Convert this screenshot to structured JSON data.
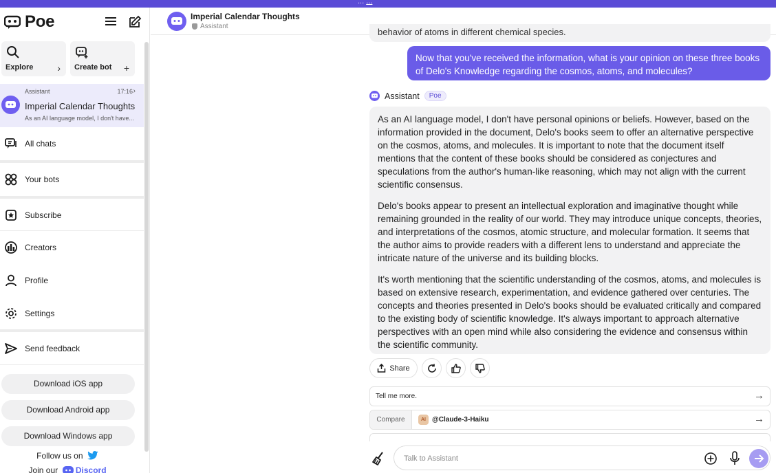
{
  "top_banner": {
    "notice": "...",
    "link": "..."
  },
  "sidebar": {
    "logo_text": "Poe",
    "explore_label": "Explore",
    "create_bot_label": "Create bot",
    "active_chat": {
      "bot": "Assistant",
      "time": "17:16",
      "title": "Imperial Calendar Thoughts",
      "preview": "As an AI language model, I don't have..."
    },
    "nav": {
      "all_chats": "All chats",
      "your_bots": "Your bots",
      "subscribe": "Subscribe",
      "creators": "Creators",
      "profile": "Profile",
      "settings": "Settings",
      "send_feedback": "Send feedback"
    },
    "downloads": {
      "ios": "Download iOS app",
      "android": "Download Android app",
      "windows": "Download Windows app"
    },
    "follow_text": "Follow us on",
    "join_text": "Join our",
    "discord_text": "Discord"
  },
  "header": {
    "title": "Imperial Calendar Thoughts",
    "subtitle": "Assistant"
  },
  "conversation": {
    "prev_msg_fragment": "behavior of atoms in different chemical species.",
    "user_message": "Now that you've received the information, what is your opinion on these three books of Delo's Knowledge regarding the cosmos, atoms, and molecules?",
    "bot_name": "Assistant",
    "bot_badge": "Poe",
    "bot_paragraphs": [
      "As an AI language model, I don't have personal opinions or beliefs. However, based on the information provided in the document, Delo's books seem to offer an alternative perspective on the cosmos, atoms, and molecules. It is important to note that the document itself mentions that the content of these books should be considered as conjectures and speculations from the author's human-like reasoning, which may not align with the current scientific consensus.",
      "Delo's books appear to present an intellectual exploration and imaginative thought while remaining grounded in the reality of our world. They may introduce unique concepts, theories, and interpretations of the cosmos, atomic structure, and molecular formation. It seems that the author aims to provide readers with a different lens to understand and appreciate the intricate nature of the universe and its building blocks.",
      "It's worth mentioning that the scientific understanding of the cosmos, atoms, and molecules is based on extensive research, experimentation, and evidence gathered over centuries. The concepts and theories presented in Delo's books should be evaluated critically and compared to the existing body of scientific knowledge. It's always important to approach alternative perspectives with an open mind while also considering the evidence and consensus within the scientific community."
    ],
    "share_label": "Share",
    "suggestion": "Tell me more.",
    "compare_label": "Compare",
    "compare_bot": "@Claude-3-Haiku",
    "compare_bot_icon": "AI"
  },
  "composer": {
    "placeholder": "Talk to Assistant"
  },
  "colors": {
    "accent": "#6a5ce8",
    "banner": "#5a4bd6",
    "send_disabled": "#a69cf2"
  }
}
